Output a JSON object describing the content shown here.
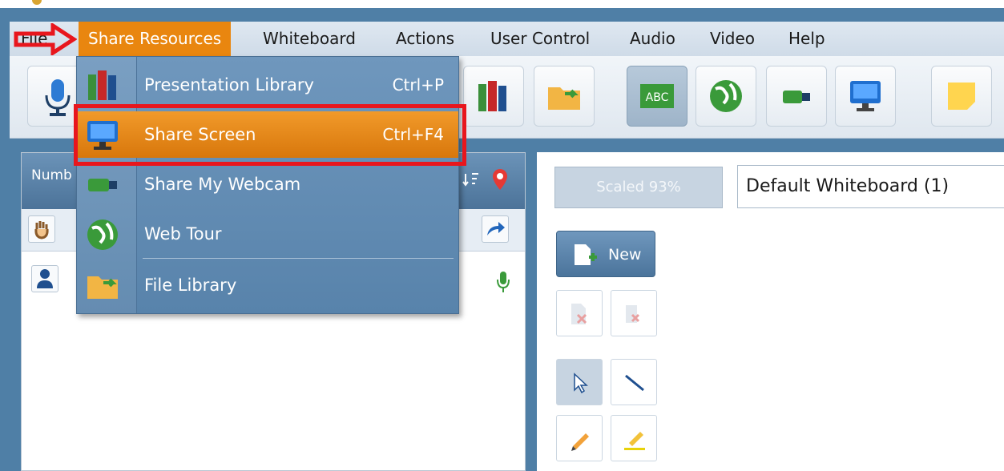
{
  "menubar": {
    "file_label": "File",
    "items": [
      "Share Resources",
      "Whiteboard",
      "Actions",
      "User Control",
      "Audio",
      "Video",
      "Help"
    ]
  },
  "share_menu": {
    "items": [
      {
        "label": "Presentation Library",
        "shortcut": "Ctrl+P",
        "icon": "books-icon"
      },
      {
        "label": "Share Screen",
        "shortcut": "Ctrl+F4",
        "icon": "monitor-icon",
        "highlighted": true
      },
      {
        "label": "Share My Webcam",
        "shortcut": "",
        "icon": "webcam-icon"
      },
      {
        "label": "Web Tour",
        "shortcut": "",
        "icon": "globe-icon"
      },
      {
        "label": "File Library",
        "shortcut": "",
        "icon": "folder-icon"
      }
    ]
  },
  "left_panel": {
    "header_label": "Numb"
  },
  "whiteboard": {
    "scale_label": "Scaled 93%",
    "select_value": "Default Whiteboard (1)",
    "new_label": "New"
  },
  "colors": {
    "accent": "#e9860f",
    "highlight_border": "#e8161d",
    "menu_blue": "#5883ab"
  }
}
